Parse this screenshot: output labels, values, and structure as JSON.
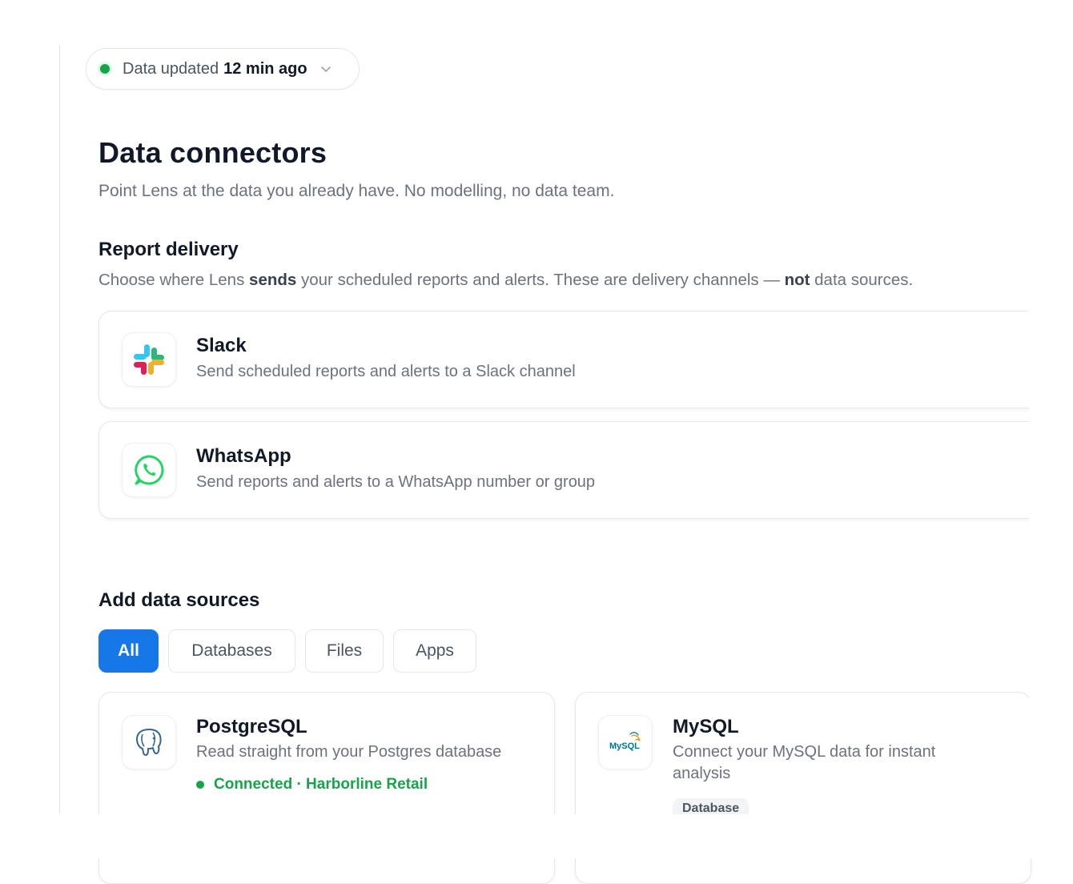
{
  "status": {
    "prefix": "Data updated",
    "time": "12 min ago",
    "indicator_color": "#16a34a"
  },
  "header": {
    "title": "Data connectors",
    "subtitle": "Point Lens at the data you already have. No modelling, no data team."
  },
  "delivery": {
    "title": "Report delivery",
    "desc_part1": "Choose where Lens",
    "desc_bold1": "sends",
    "desc_part2": "your scheduled reports and alerts. These are delivery channels —",
    "desc_bold2": "not",
    "desc_part3": "data sources.",
    "channels": [
      {
        "name": "Slack",
        "description": "Send scheduled reports and alerts to a Slack channel",
        "icon": "slack-icon"
      },
      {
        "name": "WhatsApp",
        "description": "Send reports and alerts to a WhatsApp number or group",
        "icon": "whatsapp-icon"
      }
    ]
  },
  "sources": {
    "title": "Add data sources",
    "filters": [
      "All",
      "Databases",
      "Files",
      "Apps"
    ],
    "active_filter": "All",
    "accent_color": "#1677e8",
    "items": [
      {
        "name": "PostgreSQL",
        "description": "Read straight from your Postgres database",
        "status": "Connected · Harborline Retail",
        "icon": "postgresql-icon"
      },
      {
        "name": "MySQL",
        "description_line1": "Connect your MySQL data for instant",
        "description_line2": "analysis",
        "tag": "Database",
        "icon": "mysql-icon",
        "logo_text": "MySQL"
      }
    ]
  }
}
